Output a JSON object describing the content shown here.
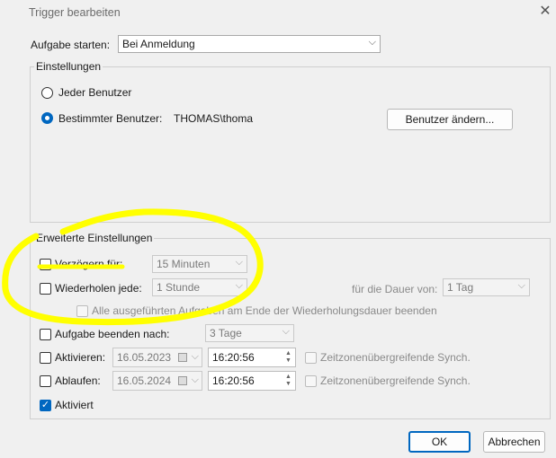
{
  "window": {
    "title": "Trigger bearbeiten",
    "close_glyph": "✕"
  },
  "start": {
    "label": "Aufgabe starten:",
    "value": "Bei Anmeldung"
  },
  "settings": {
    "title": "Einstellungen",
    "every_user": "Jeder Benutzer",
    "specific_user": "Bestimmter Benutzer:",
    "user_name": "THOMAS\\thoma",
    "change_user_button": "Benutzer ändern..."
  },
  "advanced": {
    "title": "Erweiterte Einstellungen",
    "delay_label": "Verzögern für:",
    "delay_value": "15 Minuten",
    "repeat_label": "Wiederholen jede:",
    "repeat_value": "1 Stunde",
    "duration_label": "für die Dauer von:",
    "duration_value": "1 Tag",
    "stop_all_label": "Alle ausgeführten Aufgaben am Ende der Wiederholungsdauer beenden",
    "stop_after_label": "Aufgabe beenden nach:",
    "stop_after_value": "3 Tage",
    "activate_label": "Aktivieren:",
    "activate_date": "16.05.2023",
    "activate_time": "16:20:56",
    "expire_label": "Ablaufen:",
    "expire_date": "16.05.2024",
    "expire_time": "16:20:56",
    "sync_label": "Zeitzonenübergreifende Synch.",
    "enabled_label": "Aktiviert"
  },
  "buttons": {
    "ok": "OK",
    "cancel": "Abbrechen"
  },
  "colors": {
    "accent": "#0067c0",
    "highlight": "#ffff00"
  }
}
